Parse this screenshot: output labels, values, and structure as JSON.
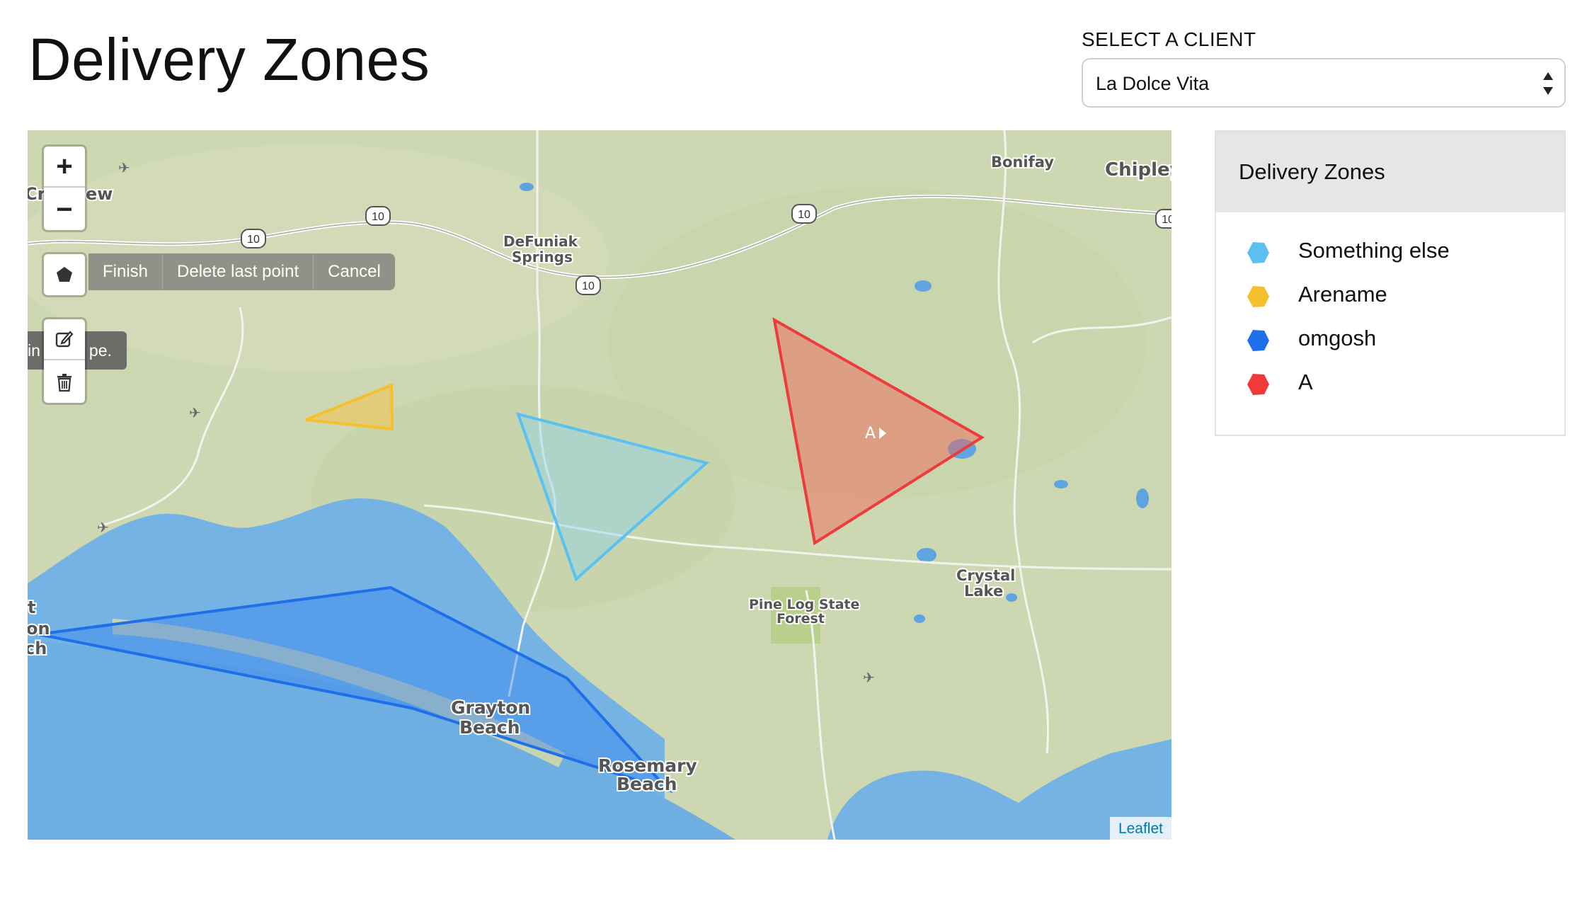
{
  "page": {
    "title": "Delivery Zones"
  },
  "client_select": {
    "label": "SELECT A CLIENT",
    "selected": "La Dolce Vita"
  },
  "map": {
    "controls": {
      "zoom_in": "+",
      "zoom_out": "−",
      "draw_polygon_icon": "pentagon-icon",
      "edit_icon": "edit-icon",
      "delete_icon": "trash-icon"
    },
    "draw_actions": [
      "Finish",
      "Delete last point",
      "Cancel"
    ],
    "tooltip_fragments": [
      "in",
      "pe."
    ],
    "attribution": "Leaflet",
    "place_labels": {
      "bonifay": "Bonifay",
      "chipley": "Chipley",
      "defuniak_1": "DeFuniak",
      "defuniak_2": "Springs",
      "crestview_fragment_1": "Cr",
      "crestview_fragment_2": "ew",
      "pine_log_1": "Pine Log State",
      "pine_log_2": "Forest",
      "crystal_1": "Crystal",
      "crystal_2": "Lake",
      "grayton_1": "Grayton",
      "grayton_2": "Beach",
      "rosemary_1": "Rosemary",
      "rosemary_2": "Beach",
      "edge_1": "t",
      "edge_2": "on",
      "edge_3": "ch",
      "zone_marker": "A"
    },
    "highway_shields": [
      "10",
      "10",
      "10",
      "10",
      "10"
    ]
  },
  "zones_panel": {
    "title": "Delivery Zones",
    "zones": [
      {
        "name": "Something else",
        "color": "#5bc0f0"
      },
      {
        "name": "Arename",
        "color": "#f5c02e"
      },
      {
        "name": "omgosh",
        "color": "#1f6fe8"
      },
      {
        "name": "A",
        "color": "#f03a3a"
      }
    ]
  }
}
